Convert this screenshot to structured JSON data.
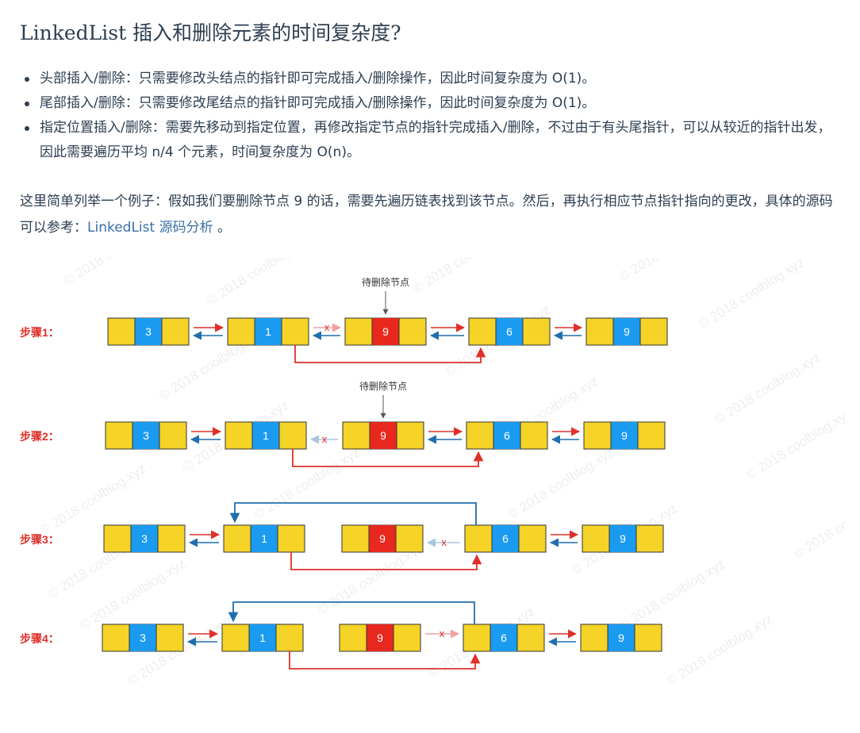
{
  "heading": "LinkedList 插入和删除元素的时间复杂度?",
  "bullets": [
    "头部插入/删除：只需要修改头结点的指针即可完成插入/删除操作，因此时间复杂度为 O(1)。",
    "尾部插入/删除：只需要修改尾结点的指针即可完成插入/删除操作，因此时间复杂度为 O(1)。",
    "指定位置插入/删除：需要先移动到指定位置，再修改指定节点的指针完成插入/删除，不过由于有头尾指针，可以从较近的指针出发，因此需要遍历平均 n/4 个元素，时间复杂度为 O(n)。"
  ],
  "intro": {
    "text": "这里简单列举一个例子：假如我们要删除节点 9 的话，需要先遍历链表找到该节点。然后，再执行相应节点指针指向的更改，具体的源码可以参考：",
    "link": "LinkedList 源码分析",
    "suffix": " 。"
  },
  "diagram": {
    "pointer_label": "待删除节点",
    "cut_mark": "x",
    "watermark": "© 2018 coolblog.xyz",
    "steps": [
      {
        "label": "步骤1：",
        "nodes": [
          "3",
          "1",
          "9",
          "6",
          "9"
        ]
      },
      {
        "label": "步骤2：",
        "nodes": [
          "3",
          "1",
          "9",
          "6",
          "9"
        ]
      },
      {
        "label": "步骤3：",
        "nodes": [
          "3",
          "1",
          "9",
          "6",
          "9"
        ]
      },
      {
        "label": "步骤4：",
        "nodes": [
          "3",
          "1",
          "9",
          "6",
          "9"
        ]
      }
    ],
    "colors": {
      "node_yellow": "#f5d327",
      "node_blue": "#1a9bf0",
      "node_red": "#e8281e",
      "next_arrow": "#e0302a",
      "prev_arrow": "#1f6fae"
    }
  }
}
